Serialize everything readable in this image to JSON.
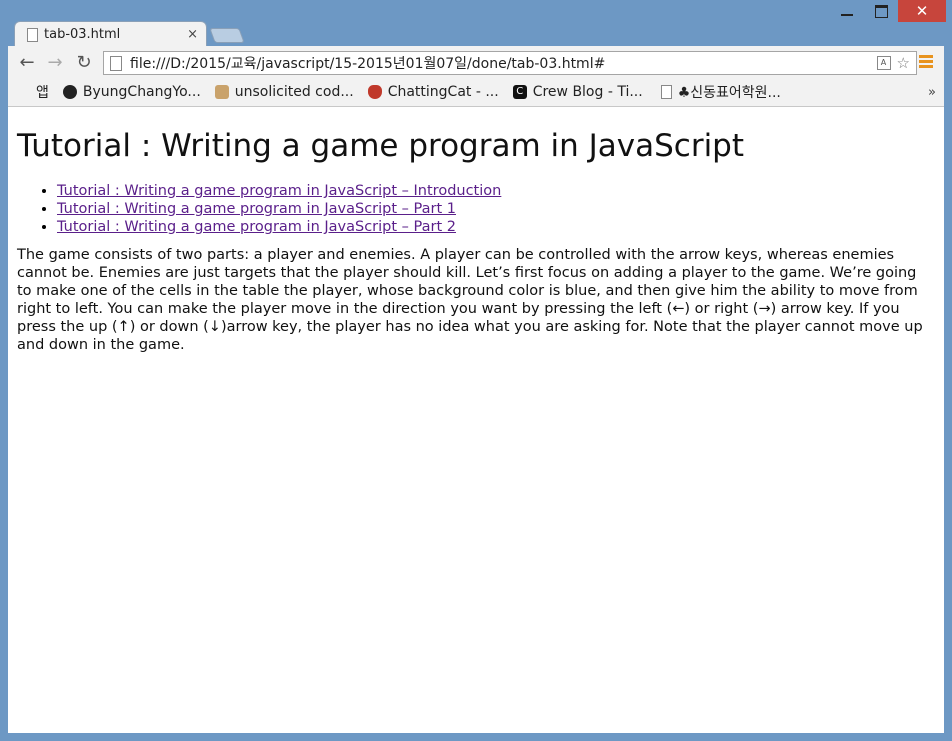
{
  "window": {
    "close_glyph": "✕"
  },
  "tab": {
    "title": "tab-03.html",
    "close_glyph": "×"
  },
  "toolbar": {
    "back_glyph": "←",
    "forward_glyph": "→",
    "reload_glyph": "↻",
    "url": "file:///D:/2015/교육/javascript/15-2015년01월07일/done/tab-03.html#",
    "star_glyph": "☆",
    "translate_glyph": "A"
  },
  "bookmarks": {
    "items": [
      {
        "label": "앱",
        "icon": "apps-icon"
      },
      {
        "label": "ByungChangYo...",
        "icon": "github-icon"
      },
      {
        "label": "unsolicited cod...",
        "icon": "dog-icon"
      },
      {
        "label": "ChattingCat - ...",
        "icon": "cat-icon"
      },
      {
        "label": "Crew Blog - Ti...",
        "icon": "crew-icon"
      },
      {
        "label": "♣신동표어학원...",
        "icon": "page-icon"
      }
    ],
    "more": "»"
  },
  "page": {
    "heading": "Tutorial : Writing a game program in JavaScript",
    "links": [
      "Tutorial : Writing a game program in JavaScript – Introduction",
      "Tutorial : Writing a game program in JavaScript – Part 1",
      "Tutorial : Writing a game program in JavaScript – Part 2"
    ],
    "paragraph": "The game consists of two parts: a player and enemies. A player can be controlled with the arrow keys, whereas enemies cannot be. Enemies are just targets that the player should kill. Let’s first focus on adding a player to the game. We’re going to make one of the cells in the table the player, whose background color is blue, and then give him the ability to move from right to left. You can make the player move in the direction you want by pressing the left (←) or right (→) arrow key. If you press the up (↑) or down (↓)arrow key, the player has no idea what you are asking for. Note that the player cannot move up and down in the game."
  },
  "colors": {
    "frame": "#6d98c4",
    "close_button": "#c7453c",
    "link_visited": "#5a1f8a",
    "menu_accent": "#e8931e"
  }
}
